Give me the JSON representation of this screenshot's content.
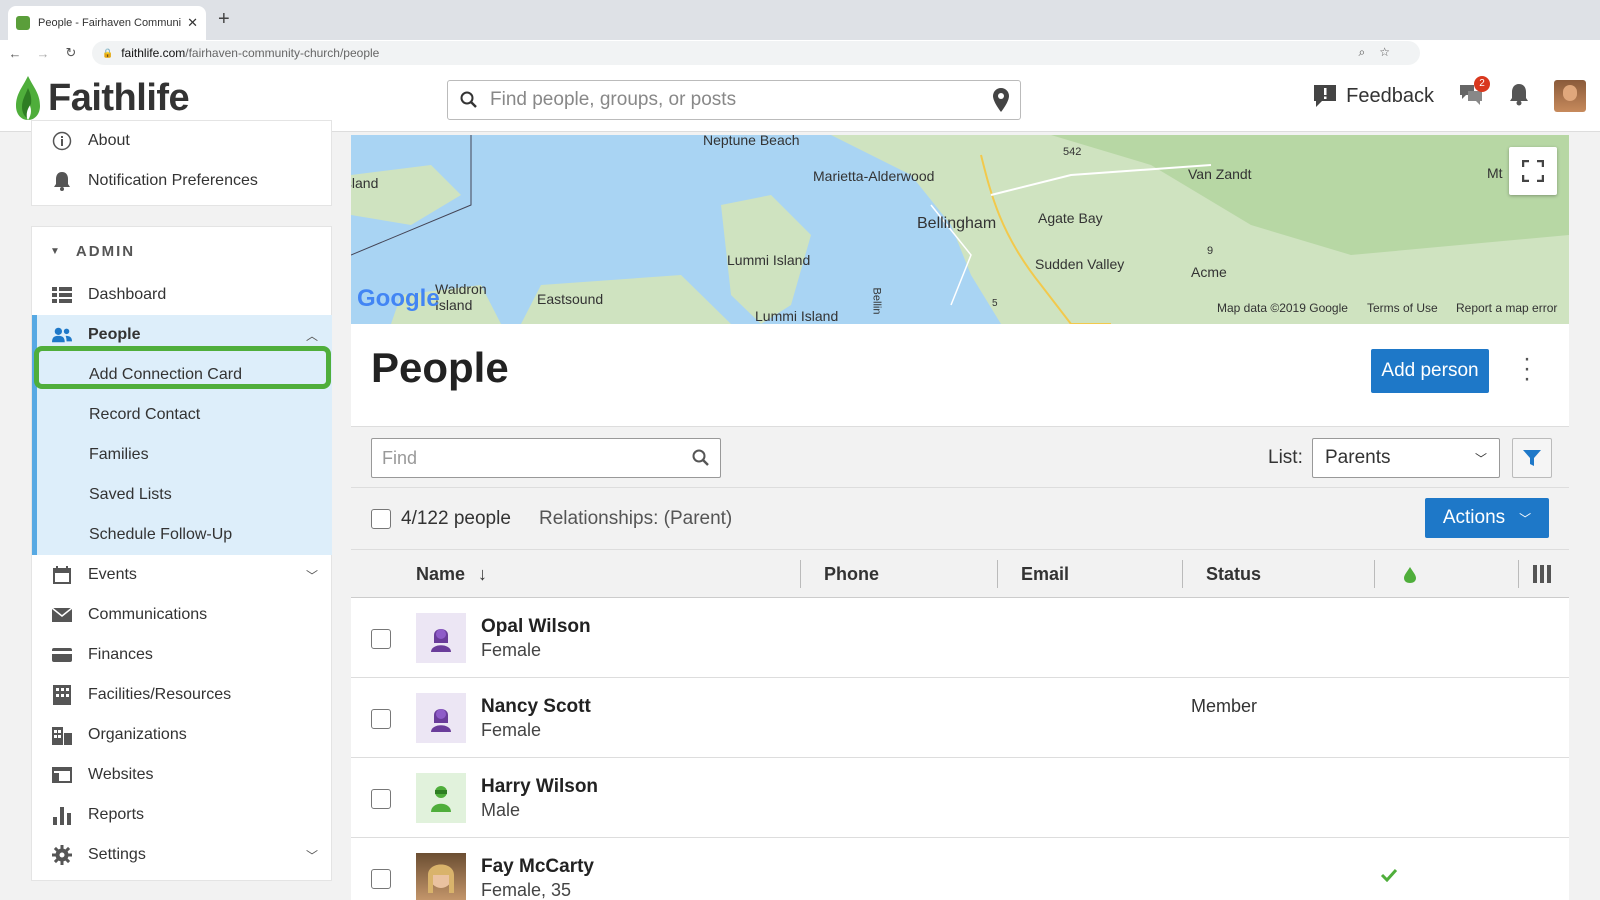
{
  "browser": {
    "tab_title": "People - Fairhaven Community C",
    "url_host": "faithlife.com",
    "url_path": "/fairhaven-community-church/people"
  },
  "header": {
    "logo_text": "Faithlife",
    "search_placeholder": "Find people, groups, or posts",
    "feedback_label": "Feedback",
    "notification_count": "2"
  },
  "sidebar": {
    "top_items": [
      {
        "label": "About",
        "icon": "info-icon"
      },
      {
        "label": "Notification Preferences",
        "icon": "bell-icon"
      }
    ],
    "admin_heading": "ADMIN",
    "items": [
      {
        "label": "Dashboard",
        "icon": "dashboard-icon"
      },
      {
        "label": "People",
        "icon": "people-icon"
      },
      {
        "label": "Add Connection Card"
      },
      {
        "label": "Record Contact"
      },
      {
        "label": "Families"
      },
      {
        "label": "Saved Lists"
      },
      {
        "label": "Schedule Follow-Up"
      },
      {
        "label": "Events",
        "icon": "calendar-icon"
      },
      {
        "label": "Communications",
        "icon": "envelope-icon"
      },
      {
        "label": "Finances",
        "icon": "credit-card-icon"
      },
      {
        "label": "Facilities/Resources",
        "icon": "building-icon"
      },
      {
        "label": "Organizations",
        "icon": "organization-icon"
      },
      {
        "label": "Websites",
        "icon": "website-icon"
      },
      {
        "label": "Reports",
        "icon": "bar-chart-icon"
      },
      {
        "label": "Settings",
        "icon": "gear-icon"
      }
    ]
  },
  "map": {
    "labels": [
      "Neptune Beach",
      "Island",
      "Marietta-Alderwood",
      "542",
      "Van Zandt",
      "Mt",
      "Bellingham",
      "Agate Bay",
      "Lummi Island",
      "Sudden Valley",
      "9",
      "Acme",
      "Waldron Island",
      "Eastsound",
      "Lummi Island",
      "Bellin",
      "5"
    ],
    "google": "Google",
    "map_data": "Map data ©2019 Google",
    "terms": "Terms of Use",
    "report": "Report a map error"
  },
  "main": {
    "title": "People",
    "add_person": "Add person",
    "find_placeholder": "Find",
    "list_label": "List:",
    "list_value": "Parents",
    "count": "4/122 people",
    "relationships": "Relationships: (Parent)",
    "actions": "Actions",
    "columns": {
      "name": "Name",
      "phone": "Phone",
      "email": "Email",
      "status": "Status"
    },
    "rows": [
      {
        "name": "Opal Wilson",
        "detail": "Female",
        "status": ""
      },
      {
        "name": "Nancy Scott",
        "detail": "Female",
        "status": "Member"
      },
      {
        "name": "Harry Wilson",
        "detail": "Male",
        "status": ""
      },
      {
        "name": "Fay McCarty",
        "detail": "Female, 35",
        "status": ""
      }
    ]
  },
  "colors": {
    "accent": "#1e78c8",
    "brand_green": "#4fae3b",
    "active_bg": "#ddeefa"
  }
}
